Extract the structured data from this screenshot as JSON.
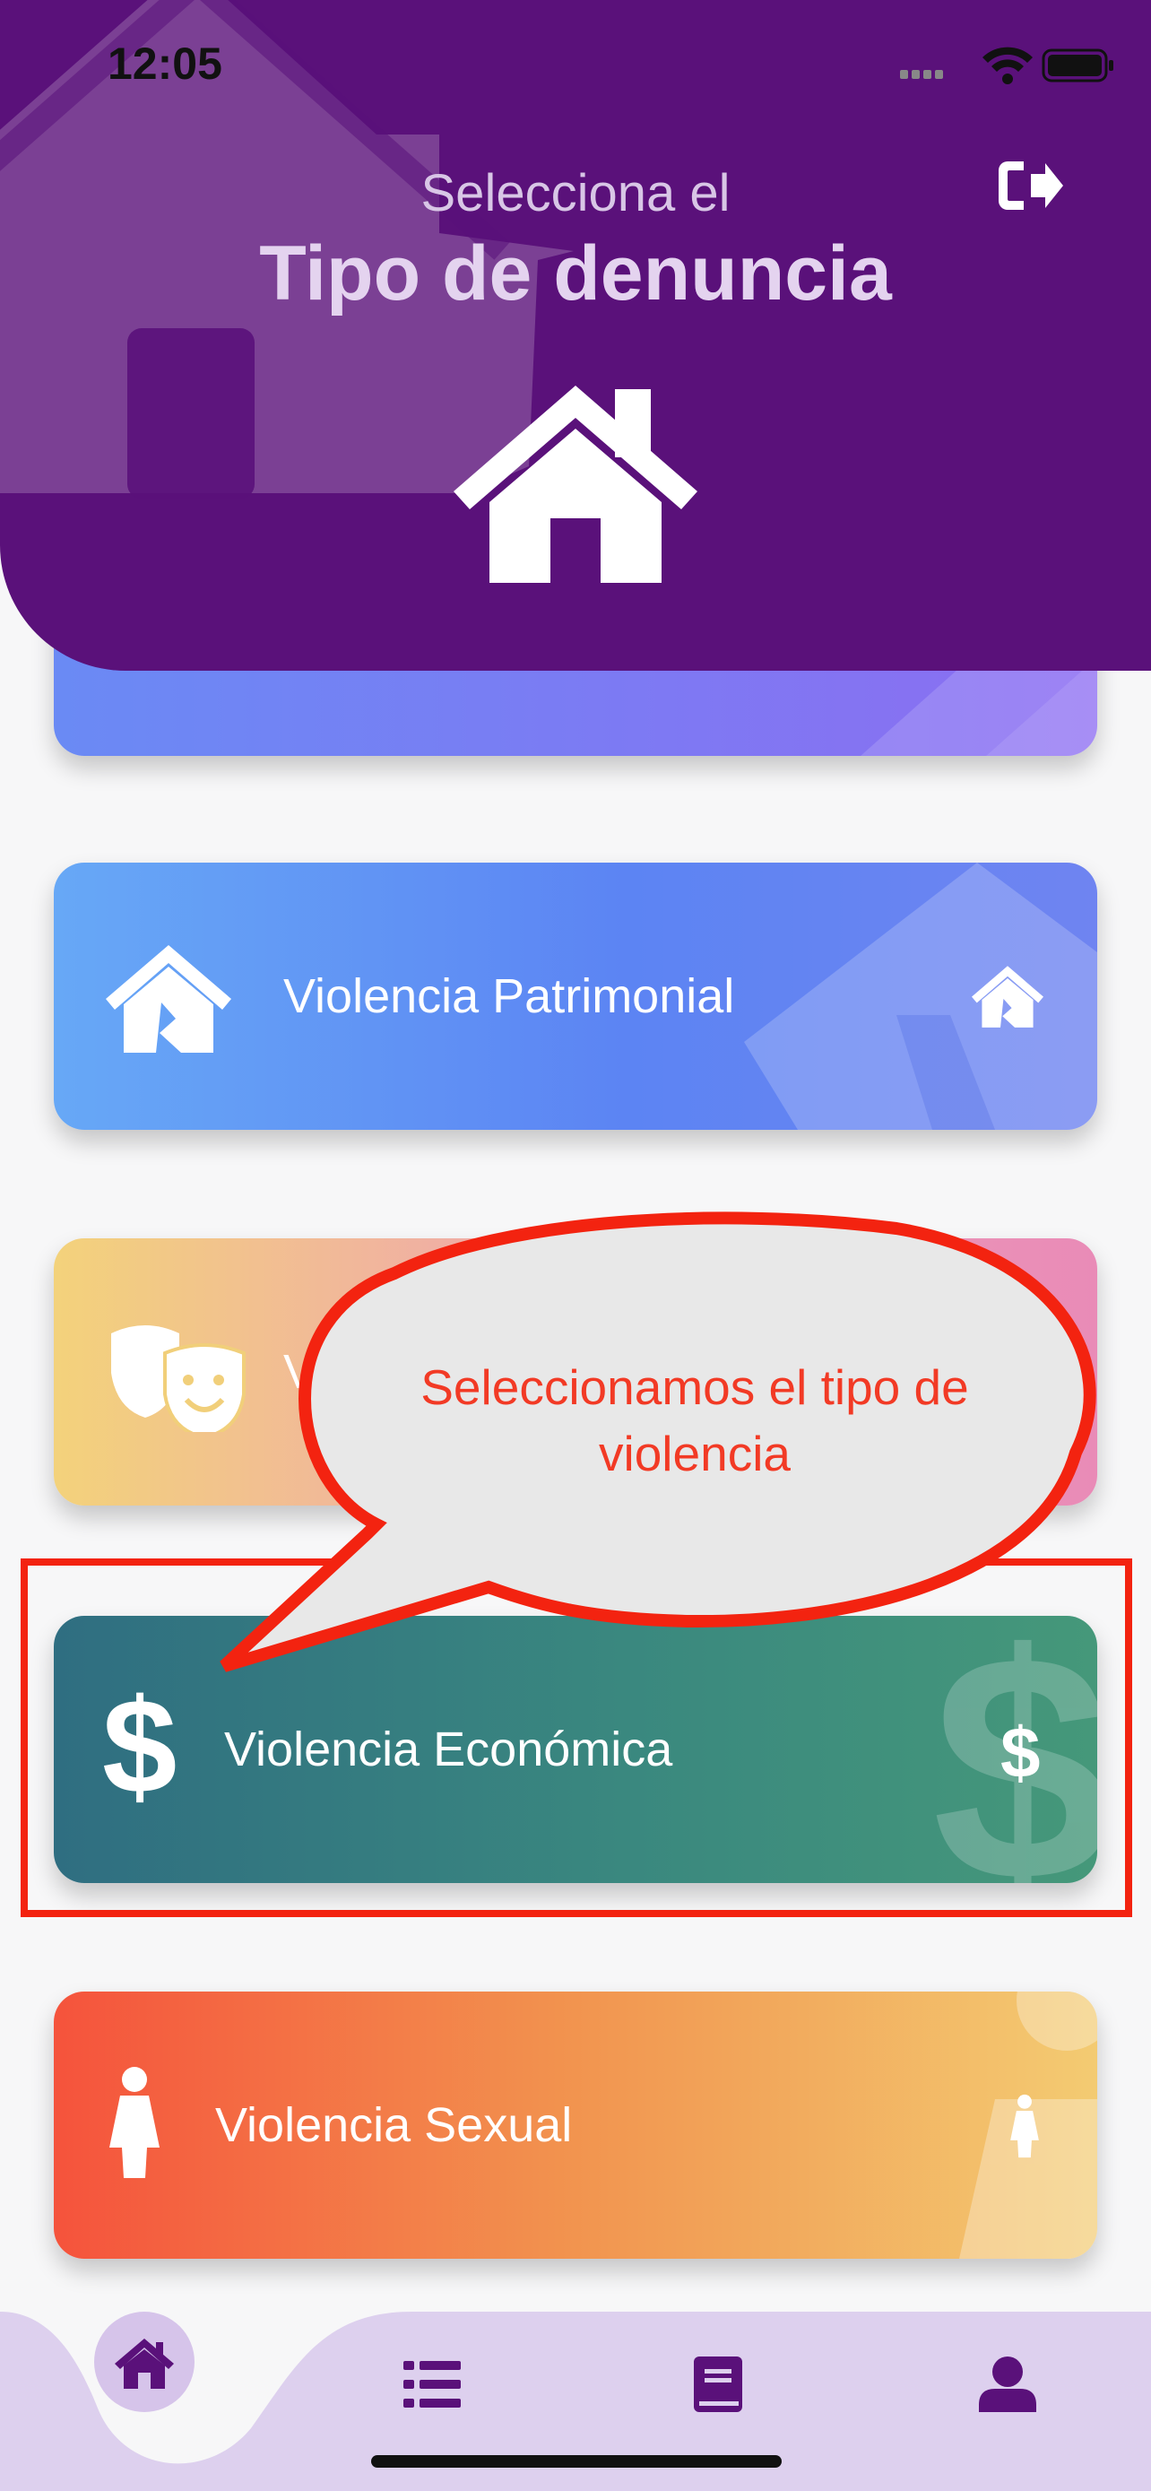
{
  "status_bar": {
    "time": "12:05"
  },
  "header": {
    "subtitle": "Selecciona el",
    "title": "Tipo de denuncia",
    "background_color": "#5a117a",
    "logout_icon": "logout-icon",
    "home_icon": "home-icon"
  },
  "cards": [
    {
      "label": "",
      "icon": "partial-icon",
      "colors": [
        "#6a8af4",
        "#8c6df2"
      ]
    },
    {
      "label": "Violencia Patrimonial",
      "icon": "house-broken-icon",
      "colors": [
        "#67a8f6",
        "#6f84f1"
      ]
    },
    {
      "label": "Violencia Psicológica",
      "icon": "theater-masks-icon",
      "colors": [
        "#f3d27b",
        "#e98bb7"
      ]
    },
    {
      "label": "Violencia Económica",
      "icon": "dollar-icon",
      "colors": [
        "#2f6e81",
        "#45987a"
      ]
    },
    {
      "label": "Violencia Sexual",
      "icon": "female-icon",
      "colors": [
        "#f5533c",
        "#f3cb72"
      ]
    }
  ],
  "annotation": {
    "callout_text": "Seleccionamos el tipo de violencia",
    "highlight_color": "#f32310",
    "bubble_fill": "#e8e8e8"
  },
  "bottom_nav": {
    "background_color": "#ddd0ee",
    "items": [
      {
        "icon": "home-icon",
        "active": true
      },
      {
        "icon": "list-icon",
        "active": false
      },
      {
        "icon": "book-icon",
        "active": false
      },
      {
        "icon": "user-icon",
        "active": false
      }
    ]
  }
}
